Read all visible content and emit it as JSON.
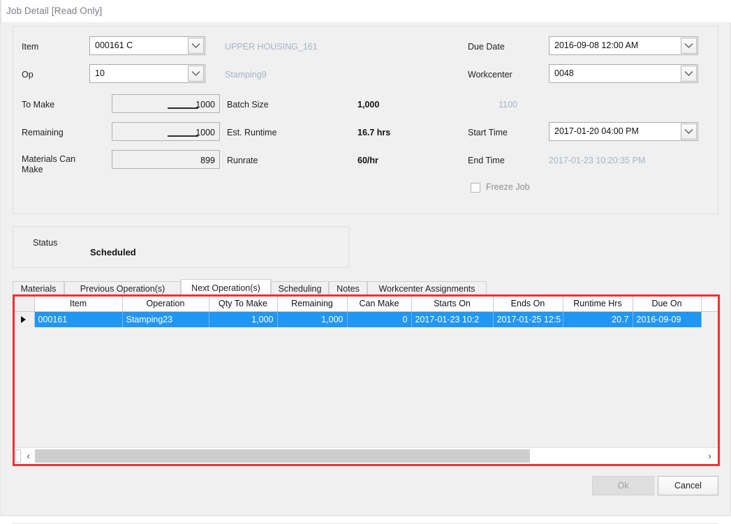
{
  "window": {
    "title": "Job Detail [Read Only]"
  },
  "form": {
    "item": {
      "label": "Item",
      "value": "000161 C",
      "description": "UPPER HOUSING_161"
    },
    "op": {
      "label": "Op",
      "value": "10",
      "description": "Stamping9"
    },
    "to_make": {
      "label": "To Make",
      "value": "1000"
    },
    "remaining": {
      "label": "Remaining",
      "value": "1000"
    },
    "materials_can_make": {
      "label": "Materials Can Make",
      "label_line1": "Materials Can",
      "label_line2": "Make",
      "value": "899"
    },
    "batch_size": {
      "label": "Batch Size",
      "value": "1,000"
    },
    "est_runtime": {
      "label": "Est. Runtime",
      "value": "16.7 hrs"
    },
    "runrate": {
      "label": "Runrate",
      "value": "60/hr"
    },
    "due_date": {
      "label": "Due Date",
      "value": "2016-09-08 12:00 AM"
    },
    "workcenter": {
      "label": "Workcenter",
      "value": "0048",
      "description": "1100"
    },
    "start_time": {
      "label": "Start Time",
      "value": "2017-01-20 04:00 PM"
    },
    "end_time": {
      "label": "End Time",
      "value": "2017-01-23 10:20:35 PM"
    },
    "freeze_job": {
      "label": "Freeze Job",
      "checked": false
    }
  },
  "status": {
    "label": "Status",
    "value": "Scheduled"
  },
  "tabs": [
    {
      "label": "Materials",
      "active": false
    },
    {
      "label": "Previous Operation(s)",
      "active": false
    },
    {
      "label": "Next Operation(s)",
      "active": true
    },
    {
      "label": "Scheduling",
      "active": false
    },
    {
      "label": "Notes",
      "active": false
    },
    {
      "label": "Workcenter Assignments",
      "active": false
    }
  ],
  "grid": {
    "columns": [
      "Item",
      "Operation",
      "Qty To Make",
      "Remaining",
      "Can Make",
      "Starts On",
      "Ends On",
      "Runtime Hrs",
      "Due On"
    ],
    "sort_column": "Item",
    "rows": [
      {
        "selected": true,
        "cells": [
          "000161",
          "Stamping23",
          "1,000",
          "1,000",
          "0",
          "2017-01-23 10:2",
          "2017-01-25 12:5",
          "20.7",
          "2016-09-09"
        ]
      }
    ]
  },
  "scrollbar": {
    "left_arrow": "‹",
    "right_arrow": "›"
  },
  "footer": {
    "ok_label": "Ok",
    "ok_enabled": false,
    "cancel_label": "Cancel",
    "cancel_enabled": true
  },
  "colors": {
    "selection_blue": "#2196f3",
    "highlight_red": "#f42f2f",
    "muted_text": "#a4b4c6"
  }
}
